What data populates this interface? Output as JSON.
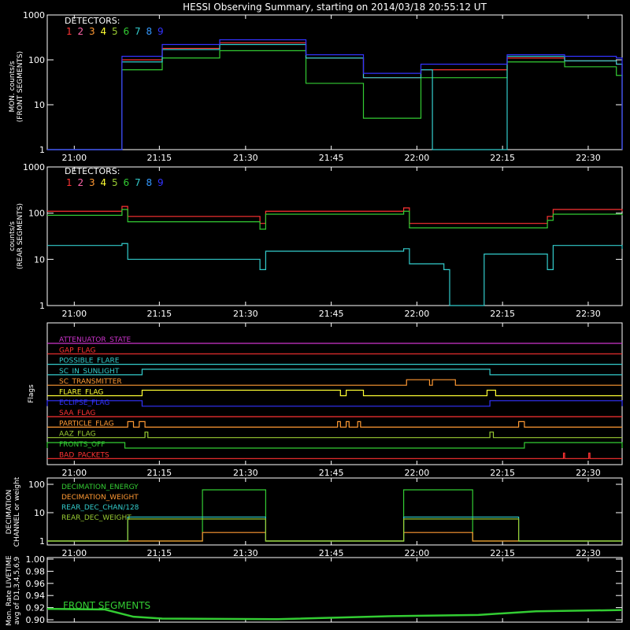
{
  "title": "HESSI Observing Summary, starting on 2014/03/18 20:55:12 UT",
  "time_ticks": [
    "21:00",
    "21:15",
    "21:30",
    "21:45",
    "22:00",
    "22:15",
    "22:30"
  ],
  "detectors_label": "DETECTORS:",
  "detectors": [
    {
      "n": "1",
      "color": "#ff3333"
    },
    {
      "n": "2",
      "color": "#ff66aa"
    },
    {
      "n": "3",
      "color": "#ff9933"
    },
    {
      "n": "4",
      "color": "#ffff33"
    },
    {
      "n": "5",
      "color": "#99cc33"
    },
    {
      "n": "6",
      "color": "#33cc33"
    },
    {
      "n": "7",
      "color": "#33cccc"
    },
    {
      "n": "8",
      "color": "#3399ff"
    },
    {
      "n": "9",
      "color": "#3333ff"
    }
  ],
  "panels": {
    "front": {
      "ylabel1": "MON. counts/s",
      "ylabel2": "(FRONT SEGMENTS)",
      "yticks": [
        "1",
        "10",
        "100",
        "1000"
      ]
    },
    "rear": {
      "ylabel1": "counts/s",
      "ylabel2": "(REAR SEGMENTS)",
      "yticks": [
        "1",
        "10",
        "100",
        "1000"
      ]
    },
    "flags": {
      "ylabel": "Flags"
    },
    "decimation": {
      "ylabel1": "DECIMATION",
      "ylabel2": "CHANNEL or weight",
      "yticks": [
        "1",
        "10",
        "100"
      ]
    },
    "livetime": {
      "ylabel1": "Mon. Rate LIVETIME",
      "ylabel2": "avg of D1,3,4,5,6,9",
      "yticks": [
        "0.90",
        "0.92",
        "0.94",
        "0.96",
        "0.98",
        "1.00"
      ],
      "legend": "FRONT SEGMENTS"
    }
  },
  "chart_data": [
    {
      "type": "line",
      "name": "front segments",
      "x_range_min": [
        0,
        100
      ],
      "ylim": [
        1,
        1000
      ],
      "yscale": "log",
      "series": [
        {
          "name": "1",
          "color": "#ff3333",
          "x": [
            0,
            12.5,
            13,
            20,
            30,
            45,
            55,
            65,
            80,
            90,
            99,
            100
          ],
          "y": [
            1,
            1,
            100,
            180,
            240,
            110,
            40,
            60,
            110,
            95,
            80,
            1
          ]
        },
        {
          "name": "6",
          "color": "#33cc33",
          "x": [
            0,
            12.5,
            13,
            20,
            30,
            45,
            55,
            65,
            80,
            90,
            99,
            100
          ],
          "y": [
            1,
            1,
            60,
            110,
            160,
            30,
            5,
            40,
            90,
            70,
            45,
            1
          ]
        },
        {
          "name": "7",
          "color": "#33cccc",
          "x": [
            0,
            12.5,
            13,
            20,
            30,
            45,
            55,
            65,
            67,
            72,
            80,
            90,
            99,
            100
          ],
          "y": [
            1,
            1,
            90,
            170,
            220,
            110,
            40,
            60,
            1,
            1,
            120,
            95,
            80,
            1
          ]
        },
        {
          "name": "9",
          "color": "#3333ff",
          "x": [
            0,
            12.5,
            13,
            20,
            30,
            45,
            55,
            65,
            80,
            90,
            99,
            100
          ],
          "y": [
            1,
            1,
            120,
            220,
            280,
            130,
            50,
            80,
            130,
            120,
            110,
            1
          ]
        }
      ]
    },
    {
      "type": "line",
      "name": "rear segments",
      "x_range_min": [
        0,
        100
      ],
      "ylim": [
        1,
        1000
      ],
      "yscale": "log",
      "series": [
        {
          "name": "1",
          "color": "#ff3333",
          "x": [
            0,
            13,
            14,
            37,
            38,
            62,
            63,
            87,
            88,
            100
          ],
          "y": [
            110,
            140,
            85,
            60,
            110,
            130,
            60,
            85,
            120,
            110
          ]
        },
        {
          "name": "6",
          "color": "#33cc33",
          "x": [
            0,
            13,
            14,
            37,
            38,
            62,
            63,
            87,
            88,
            100
          ],
          "y": [
            90,
            120,
            65,
            45,
            95,
            110,
            48,
            70,
            95,
            90
          ]
        },
        {
          "name": "7",
          "color": "#33cccc",
          "x": [
            0,
            13,
            14,
            37,
            38,
            62,
            63,
            69,
            70,
            75,
            76,
            87,
            88,
            100
          ],
          "y": [
            20,
            22,
            10,
            6,
            15,
            17,
            8,
            6,
            1,
            1,
            13,
            6,
            20,
            17
          ]
        }
      ]
    },
    {
      "type": "line",
      "name": "flags",
      "flags": [
        {
          "name": "ATTENUATOR_STATE",
          "color": "#cc33cc",
          "segments": []
        },
        {
          "name": "GAP_FLAG",
          "color": "#ff3333",
          "segments": []
        },
        {
          "name": "POSSIBLE_FLARE",
          "color": "#33cccc",
          "segments": []
        },
        {
          "name": "SC_IN_SUNLIGHT",
          "color": "#33cccc",
          "segments": [
            [
              16.5,
              77
            ]
          ]
        },
        {
          "name": "SC_TRANSMITTER",
          "color": "#ff9933",
          "segments": [
            [
              62.5,
              66.5
            ],
            [
              67,
              71
            ]
          ]
        },
        {
          "name": "FLARE_FLAG",
          "color": "#ffff33",
          "segments": [
            [
              16.5,
              51
            ],
            [
              52,
              55
            ],
            [
              76.5,
              78
            ]
          ]
        },
        {
          "name": "ECLIPSE_FLAG",
          "color": "#3333ff",
          "segments": [
            [
              0,
              16.5
            ],
            [
              77,
              100
            ]
          ]
        },
        {
          "name": "SAA_FLAG",
          "color": "#ff3333",
          "segments": []
        },
        {
          "name": "PARTICLE_FLAG",
          "color": "#ff9933",
          "segments": [
            [
              14,
              15
            ],
            [
              16,
              17
            ],
            [
              50.5,
              51
            ],
            [
              52,
              52.5
            ],
            [
              54,
              54.5
            ],
            [
              82,
              83
            ]
          ]
        },
        {
          "name": "AAZ_FLAG",
          "color": "#99cc33",
          "segments": [
            [
              17,
              17.5
            ],
            [
              77,
              77.6
            ]
          ]
        },
        {
          "name": "FRONTS_OFF",
          "color": "#33cc33",
          "segments": [
            [
              0,
              13.5
            ],
            [
              83,
              100
            ]
          ]
        },
        {
          "name": "BAD_PACKETS",
          "color": "#ff3333",
          "segments": [
            [
              89.8,
              90
            ],
            [
              94.2,
              94.4
            ]
          ]
        }
      ]
    },
    {
      "type": "line",
      "name": "decimation",
      "ylim": [
        1,
        100
      ],
      "yscale": "log",
      "series": [
        {
          "name": "DECIMATION_ENERGY",
          "color": "#33cc33",
          "x": [
            0,
            27,
            27,
            38,
            38,
            62,
            62,
            74,
            74,
            100
          ],
          "y": [
            1,
            1,
            64,
            64,
            1,
            1,
            64,
            64,
            1,
            1
          ]
        },
        {
          "name": "DECIMATION_WEIGHT",
          "color": "#ff9933",
          "x": [
            0,
            27,
            27,
            38,
            38,
            62,
            62,
            74,
            74,
            100
          ],
          "y": [
            1,
            1,
            2,
            2,
            1,
            1,
            2,
            2,
            1,
            1
          ]
        },
        {
          "name": "REAR_DEC_CHAN/128",
          "color": "#33cccc",
          "x": [
            0,
            14,
            14,
            38,
            38,
            62,
            62,
            82,
            82,
            100
          ],
          "y": [
            1,
            1,
            7,
            7,
            1,
            1,
            7,
            7,
            1,
            1
          ]
        },
        {
          "name": "REAR_DEC_WEIGHT",
          "color": "#99cc33",
          "x": [
            0,
            14,
            14,
            38,
            38,
            62,
            62,
            82,
            82,
            100
          ],
          "y": [
            1,
            1,
            6,
            6,
            1,
            1,
            6,
            6,
            1,
            1
          ]
        }
      ]
    },
    {
      "type": "line",
      "name": "livetime",
      "ylim": [
        0.9,
        1.0
      ],
      "series": [
        {
          "name": "FRONT SEGMENTS",
          "color": "#33cc33",
          "x": [
            0,
            10,
            15,
            20,
            40,
            60,
            75,
            85,
            100
          ],
          "y": [
            0.918,
            0.917,
            0.905,
            0.902,
            0.901,
            0.906,
            0.908,
            0.914,
            0.916
          ]
        }
      ]
    }
  ]
}
